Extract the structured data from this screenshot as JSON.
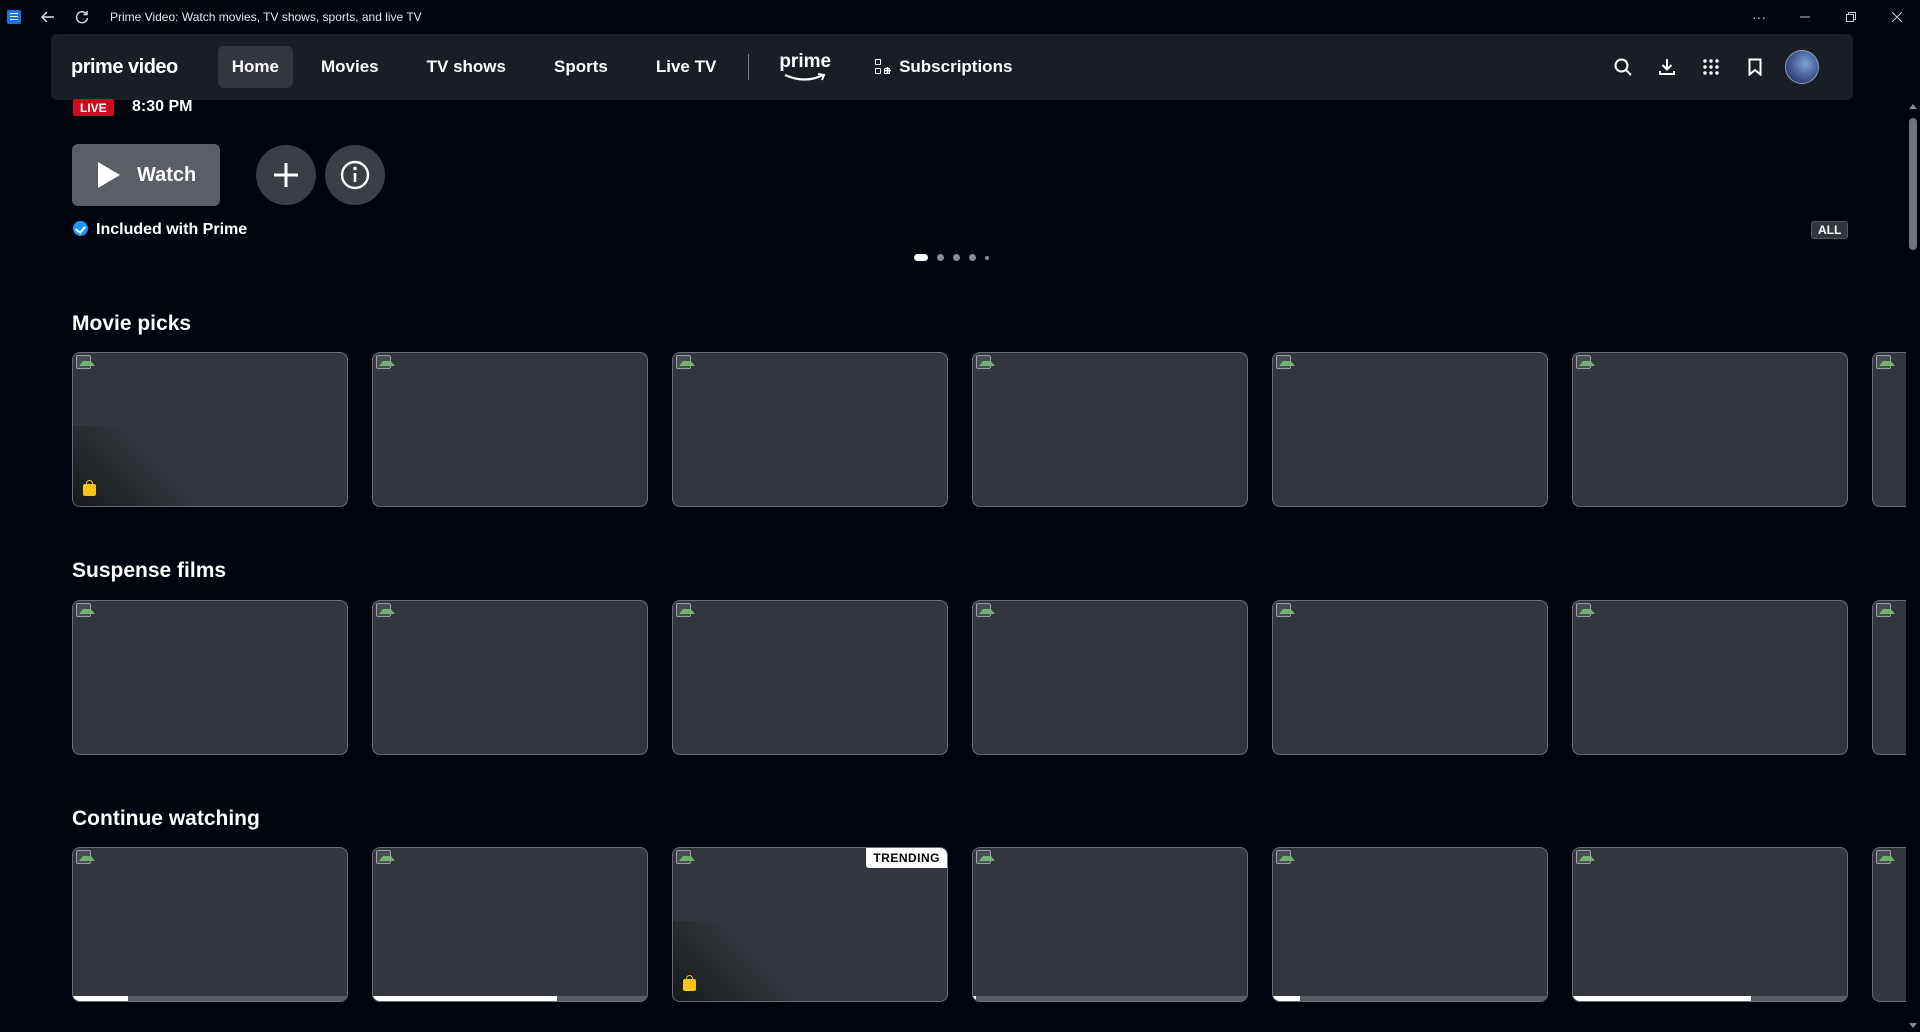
{
  "window": {
    "title": "Prime Video: Watch movies, TV shows, sports, and live TV"
  },
  "nav": {
    "logo": "prime video",
    "items": [
      "Home",
      "Movies",
      "TV shows",
      "Sports",
      "Live TV"
    ],
    "prime_label": "prime",
    "subscriptions": "Subscriptions"
  },
  "hero": {
    "live_badge": "LIVE",
    "time": "8:30 PM",
    "watch_label": "Watch",
    "included": "Included with Prime",
    "all_badge": "ALL",
    "carousel_active_index": 0,
    "carousel_count": 5
  },
  "rows": [
    {
      "title": "Movie picks",
      "cards": [
        {
          "bag": true
        },
        {},
        {},
        {},
        {},
        {},
        {
          "partial": true
        }
      ]
    },
    {
      "title": "Suspense films",
      "cards": [
        {},
        {},
        {},
        {},
        {},
        {},
        {
          "partial": true
        }
      ]
    },
    {
      "title": "Continue watching",
      "cards": [
        {
          "progress": 0.2
        },
        {
          "progress": 0.67
        },
        {
          "bag": true,
          "badge": "TRENDING"
        },
        {
          "progress": 0.01
        },
        {
          "progress": 0.1
        },
        {
          "progress": 0.65
        },
        {
          "partial": true
        }
      ]
    }
  ],
  "colors": {
    "background": "#00050d",
    "navbar": "#191e25",
    "live_red": "#cc0c1f",
    "check_blue": "#1a98ff",
    "store_bag": "#f5c518"
  }
}
